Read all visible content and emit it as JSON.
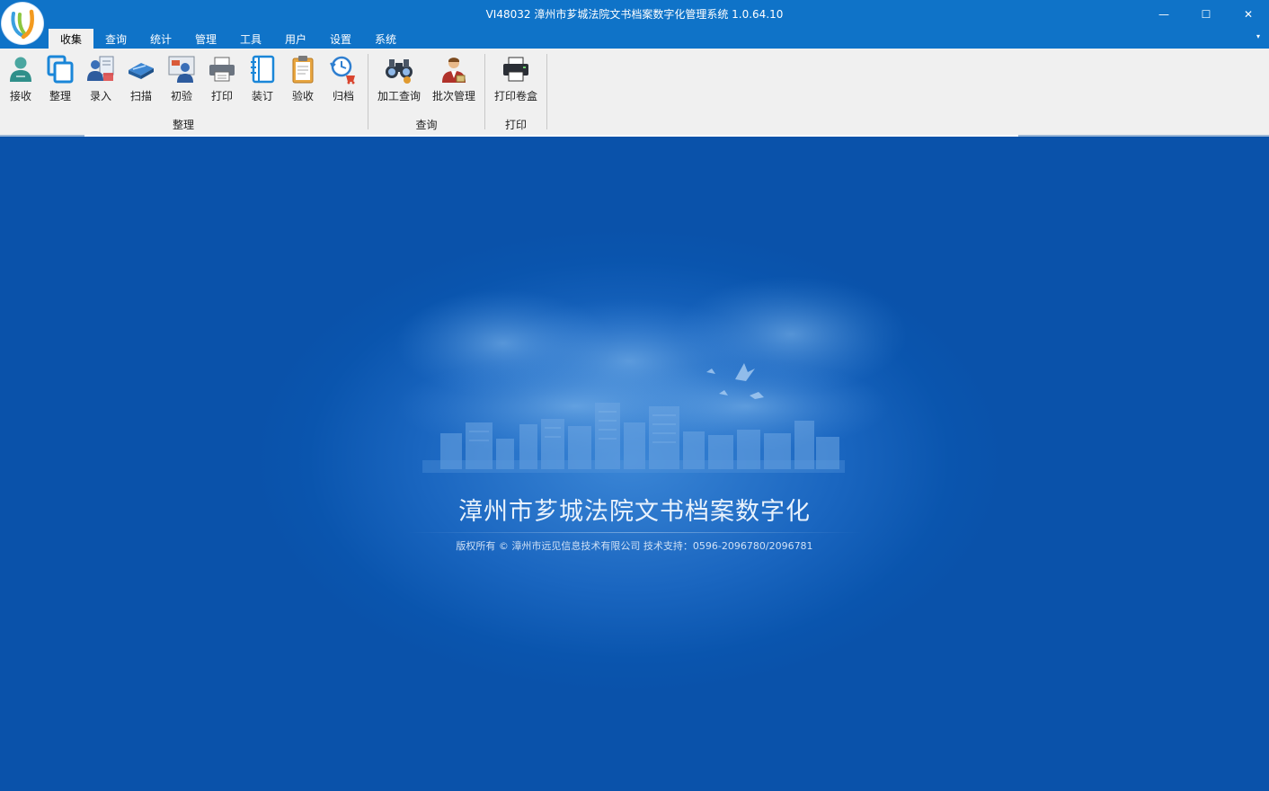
{
  "window": {
    "title": "VI48032 漳州市芗城法院文书档案数字化管理系统 1.0.64.10",
    "controls": {
      "minimize": "—",
      "maximize": "☐",
      "close": "✕"
    }
  },
  "tabs": [
    {
      "label": "收集",
      "active": true
    },
    {
      "label": "查询"
    },
    {
      "label": "统计"
    },
    {
      "label": "管理"
    },
    {
      "label": "工具"
    },
    {
      "label": "用户"
    },
    {
      "label": "设置"
    },
    {
      "label": "系统"
    }
  ],
  "ribbon_toggle": "▾",
  "ribbon": {
    "groups": [
      {
        "label": "整理",
        "buttons": [
          {
            "label": "接收",
            "icon": "user-receive-icon"
          },
          {
            "label": "整理",
            "icon": "copy-pages-icon"
          },
          {
            "label": "录入",
            "icon": "user-form-icon"
          },
          {
            "label": "扫描",
            "icon": "scanner-icon"
          },
          {
            "label": "初验",
            "icon": "user-review-icon"
          },
          {
            "label": "打印",
            "icon": "printer-icon"
          },
          {
            "label": "装订",
            "icon": "binder-icon"
          },
          {
            "label": "验收",
            "icon": "clipboard-icon"
          },
          {
            "label": "归档",
            "icon": "archive-history-icon"
          }
        ]
      },
      {
        "label": "查询",
        "buttons": [
          {
            "label": "加工查询",
            "icon": "binoculars-icon"
          },
          {
            "label": "批次管理",
            "icon": "manager-icon"
          }
        ]
      },
      {
        "label": "打印",
        "buttons": [
          {
            "label": "打印卷盒",
            "icon": "box-printer-icon"
          }
        ]
      }
    ]
  },
  "splash": {
    "title": "漳州市芗城法院文书档案数字化",
    "copyright": "版权所有 © 漳州市远见信息技术有限公司  技术支持：0596-2096780/2096781"
  },
  "colors": {
    "titlebar": "#0f73c8",
    "ribbon": "#f0f0f0",
    "main_bg": "#0a56b0"
  }
}
